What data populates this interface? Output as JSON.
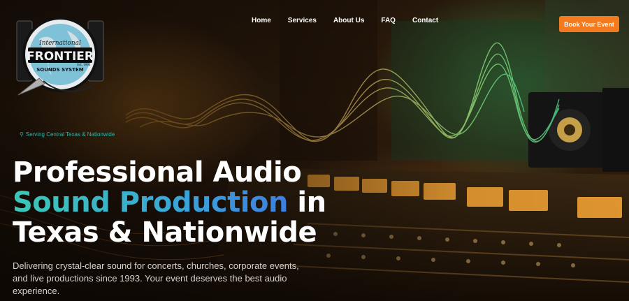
{
  "brand": {
    "logo_top_text": "International",
    "logo_main_text": "FRONTIER",
    "logo_sub_text": "SOUNDS SYSTEM",
    "logo_est_text": "Est. 1993"
  },
  "nav": {
    "items": [
      {
        "label": "Home"
      },
      {
        "label": "Services"
      },
      {
        "label": "About Us"
      },
      {
        "label": "FAQ"
      },
      {
        "label": "Contact"
      }
    ],
    "cta_label": "Book Your Event"
  },
  "hero": {
    "tagline": "Serving Central Texas & Nationwide",
    "headline_line1": "Professional Audio",
    "headline_gradient": "Sound Production",
    "headline_line2_rest": " in",
    "headline_line3": "Texas & Nationwide",
    "subtext": "Delivering crystal-clear sound for concerts, churches, corporate events, and live productions since 1993. Your event deserves the best audio experience."
  },
  "colors": {
    "cta": "#f47a1f",
    "accent_teal": "#2bb5a8",
    "gradient_start": "#3cc7b4",
    "gradient_end": "#3d7fe0"
  },
  "icons": {
    "tagline_icon": "map-pin-icon"
  }
}
